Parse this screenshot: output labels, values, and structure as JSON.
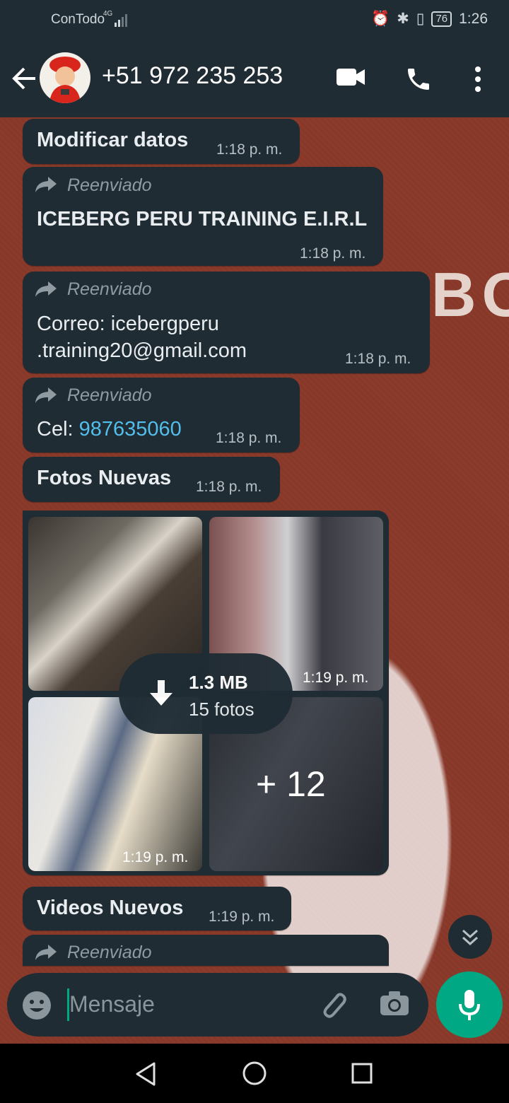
{
  "status_bar": {
    "carrier": "ConTodo",
    "network": "4G",
    "battery": "76",
    "time": "1:26"
  },
  "header": {
    "contact": "+51 972 235 253",
    "icons": [
      "back-arrow-icon",
      "video-call-icon",
      "phone-icon",
      "more-options-icon"
    ]
  },
  "messages": {
    "m1": {
      "text": "Modificar datos",
      "time": "1:18 p. m."
    },
    "m2": {
      "forwarded": "Reenviado",
      "text": "ICEBERG PERU TRAINING E.I.R.L",
      "time": "1:18 p. m."
    },
    "m3": {
      "forwarded": "Reenviado",
      "line1": "Correo: icebergperu",
      "line2": ".training20@gmail.com",
      "time": "1:18 p. m."
    },
    "m4": {
      "forwarded": "Reenviado",
      "label": "Cel: ",
      "phone": "987635060",
      "time": "1:18 p. m."
    },
    "m5": {
      "text": "Fotos Nuevas",
      "time": "1:18 p. m."
    },
    "album": {
      "size": "1.3 MB",
      "count": "15 fotos",
      "more": "+ 12",
      "time_top": "1:19 p. m.",
      "time_bottom": "1:19 p. m."
    },
    "m6": {
      "text": "Videos Nuevos",
      "time": "1:19 p. m."
    },
    "m7": {
      "forwarded": "Reenviado"
    }
  },
  "wallpaper_text": "BO",
  "composer": {
    "placeholder": "Mensaje"
  },
  "colors": {
    "bar": "#1f2c34",
    "accent": "#00a884",
    "link": "#53bdeb",
    "wallpaper": "#8a3a2a"
  }
}
